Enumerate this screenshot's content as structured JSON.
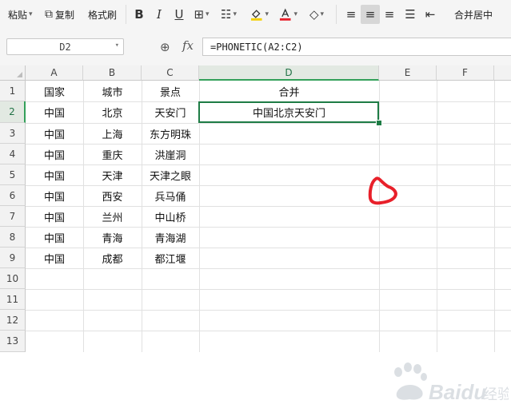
{
  "toolbar": {
    "paste_label": "粘贴",
    "copy_label": "复制",
    "format_painter_label": "格式刷",
    "bold_glyph": "B",
    "italic_glyph": "I",
    "underline_glyph": "U",
    "merge_center_label": "合并居中"
  },
  "formula_bar": {
    "cell_ref": "D2",
    "fx_label": "fx",
    "formula": "=PHONETIC(A2:C2)"
  },
  "columns": [
    "A",
    "B",
    "C",
    "D",
    "E",
    "F"
  ],
  "rows": [
    "1",
    "2",
    "3",
    "4",
    "5",
    "6",
    "7",
    "8",
    "9",
    "10",
    "11",
    "12",
    "13"
  ],
  "header_row": {
    "a": "国家",
    "b": "城市",
    "c": "景点",
    "d": "合并"
  },
  "data_rows": [
    {
      "a": "中国",
      "b": "北京",
      "c": "天安门",
      "d": "中国北京天安门"
    },
    {
      "a": "中国",
      "b": "上海",
      "c": "东方明珠",
      "d": ""
    },
    {
      "a": "中国",
      "b": "重庆",
      "c": "洪崖洞",
      "d": ""
    },
    {
      "a": "中国",
      "b": "天津",
      "c": "天津之眼",
      "d": ""
    },
    {
      "a": "中国",
      "b": "西安",
      "c": "兵马俑",
      "d": ""
    },
    {
      "a": "中国",
      "b": "兰州",
      "c": "中山桥",
      "d": ""
    },
    {
      "a": "中国",
      "b": "青海",
      "c": "青海湖",
      "d": ""
    },
    {
      "a": "中国",
      "b": "成都",
      "c": "都江堰",
      "d": ""
    }
  ],
  "selection": {
    "column": "D",
    "row": "2"
  },
  "watermark": {
    "brand_text": "Baidu",
    "suffix_text": "经验"
  },
  "colors": {
    "selection_green": "#1e7c45",
    "annotation_red": "#e8202a",
    "toolbar_bg": "#f5f5f5"
  },
  "icons": [
    "copy-icon",
    "bold-icon",
    "italic-icon",
    "underline-icon",
    "borders-icon",
    "cell-style-icon",
    "fill-color-icon",
    "font-color-icon",
    "eraser-icon",
    "align-left-icon",
    "align-center-icon",
    "align-right-icon",
    "justify-icon",
    "wrap-icon",
    "zoom-icon"
  ]
}
